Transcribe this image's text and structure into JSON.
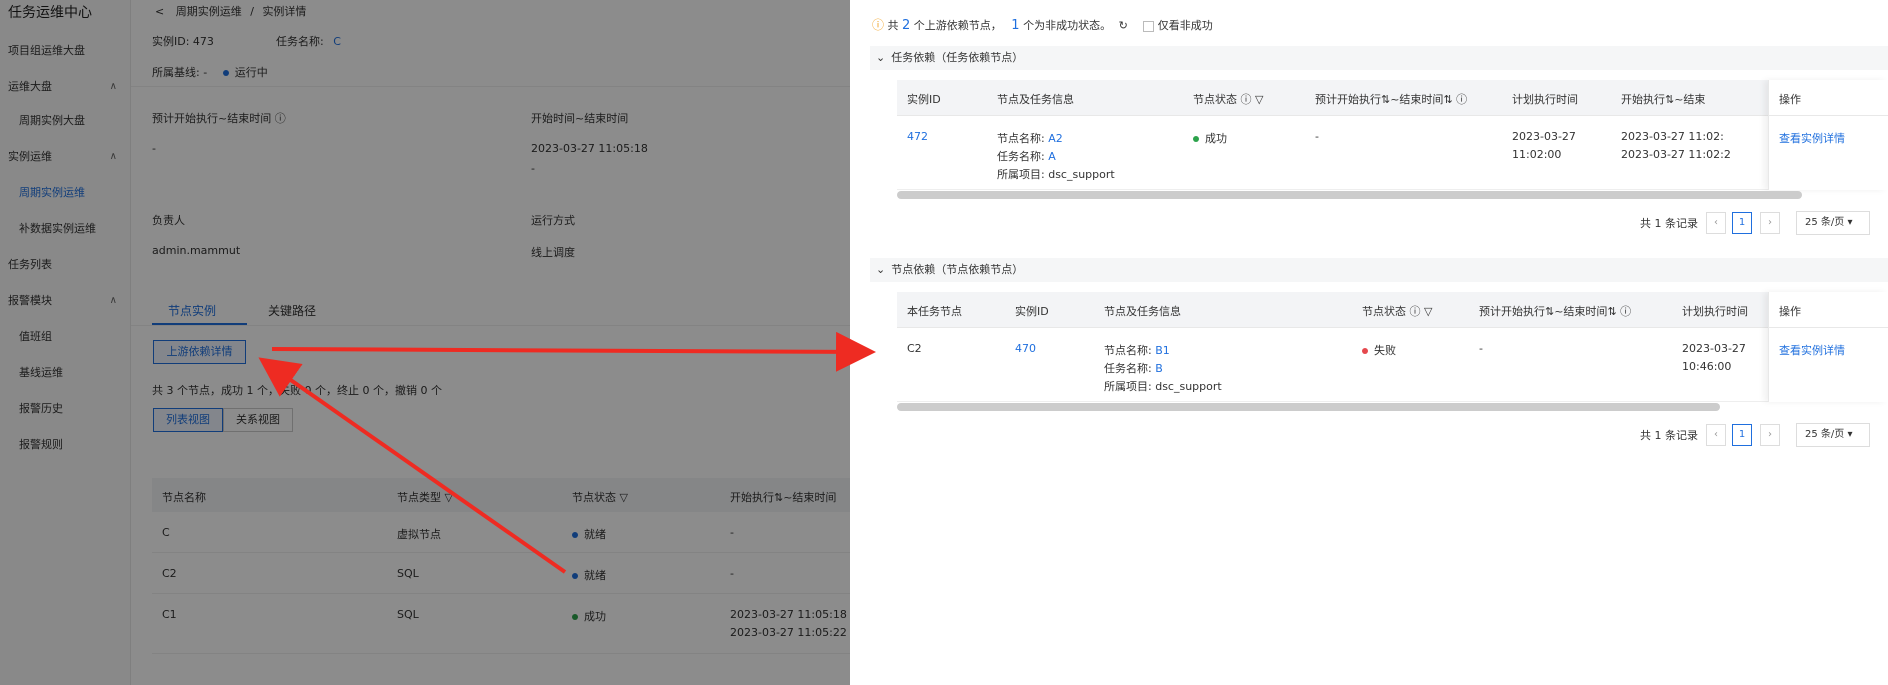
{
  "sidebar": {
    "title": "任务运维中心",
    "items": [
      {
        "label": "项目组运维大盘"
      },
      {
        "label": "运维大盘"
      },
      {
        "label": "周期实例大盘"
      },
      {
        "label": "实例运维"
      },
      {
        "label": "周期实例运维"
      },
      {
        "label": "补数据实例运维"
      },
      {
        "label": "任务列表"
      },
      {
        "label": "报警模块"
      },
      {
        "label": "值班组"
      },
      {
        "label": "基线运维"
      },
      {
        "label": "报警历史"
      },
      {
        "label": "报警规则"
      }
    ]
  },
  "breadcrumb": {
    "back": "<",
    "parent": "周期实例运维",
    "sep": "/",
    "current": "实例详情"
  },
  "info": {
    "instance_id_label": "实例ID:",
    "instance_id": "473",
    "task_name_label": "任务名称:",
    "task_name": "C",
    "baseline_label": "所属基线:",
    "baseline": "-",
    "run_status": "运行中",
    "expected_label": "预计开始执行~结束时间",
    "expected_value": "-",
    "start_end_label": "开始时间~结束时间",
    "start_value": "2023-03-27 11:05:18",
    "end_value": "-",
    "owner_label": "负责人",
    "owner": "admin.mammut",
    "run_mode_label": "运行方式",
    "run_mode": "线上调度"
  },
  "tabs": [
    {
      "label": "节点实例"
    },
    {
      "label": "关键路径"
    }
  ],
  "upstream_btn": "上游依赖详情",
  "summary": "共 3 个节点，成功 1 个，失败 0 个，终止 0 个，撤销 0 个",
  "view_btns": [
    "列表视图",
    "关系视图"
  ],
  "node_table": {
    "headers": [
      "节点名称",
      "节点类型",
      "节点状态",
      "开始执行",
      "~结束时间"
    ],
    "rows": [
      {
        "name": "C",
        "type": "虚拟节点",
        "status": "就绪",
        "start": "-",
        "end": ""
      },
      {
        "name": "C2",
        "type": "SQL",
        "status": "就绪",
        "start": "-",
        "end": ""
      },
      {
        "name": "C1",
        "type": "SQL",
        "status": "成功",
        "start": "2023-03-27 11:05:18",
        "end": "2023-03-27 11:05:22"
      }
    ]
  },
  "panel": {
    "summary_prefix": "共",
    "upstream_count": "2",
    "summary_mid": "个上游依赖节点，",
    "fail_count": "1",
    "summary_suffix": "个为非成功状态。",
    "only_fail_label": "仅看非成功",
    "task_dep": {
      "title": "任务依赖（任务依赖节点）",
      "headers": [
        "实例ID",
        "节点及任务信息",
        "节点状态",
        "预计开始执行",
        "~结束时间",
        "计划执行时间",
        "开始执行",
        "~结束",
        "操作"
      ],
      "row": {
        "id": "472",
        "node_label": "节点名称:",
        "node": "A2",
        "task_label": "任务名称:",
        "task": "A",
        "project_label": "所属项目:",
        "project": "dsc_support",
        "status": "成功",
        "expected": "-",
        "plan_date": "2023-03-27",
        "plan_time": "11:02:00",
        "start1": "2023-03-27 11:02:",
        "start2": "2023-03-27 11:02:2",
        "action": "查看实例详情"
      },
      "total": "共 1 条记录",
      "page": "1",
      "page_size": "25 条/页"
    },
    "node_dep": {
      "title": "节点依赖（节点依赖节点）",
      "headers": [
        "本任务节点",
        "实例ID",
        "节点及任务信息",
        "节点状态",
        "预计开始执行",
        "~结束时间",
        "计划执行时间",
        "操作"
      ],
      "row": {
        "own_node": "C2",
        "id": "470",
        "node_label": "节点名称:",
        "node": "B1",
        "task_label": "任务名称:",
        "task": "B",
        "project_label": "所属项目:",
        "project": "dsc_support",
        "status": "失败",
        "expected": "-",
        "plan_date": "2023-03-27",
        "plan_time": "10:46:00",
        "action": "查看实例详情"
      },
      "total": "共 1 条记录",
      "page": "1",
      "page_size": "25 条/页"
    }
  },
  "colors": {
    "accent": "#1f6fde",
    "success": "#2ca24b",
    "fail": "#e5484d",
    "ready": "#1f6fde",
    "arrow": "#ee2b22"
  }
}
